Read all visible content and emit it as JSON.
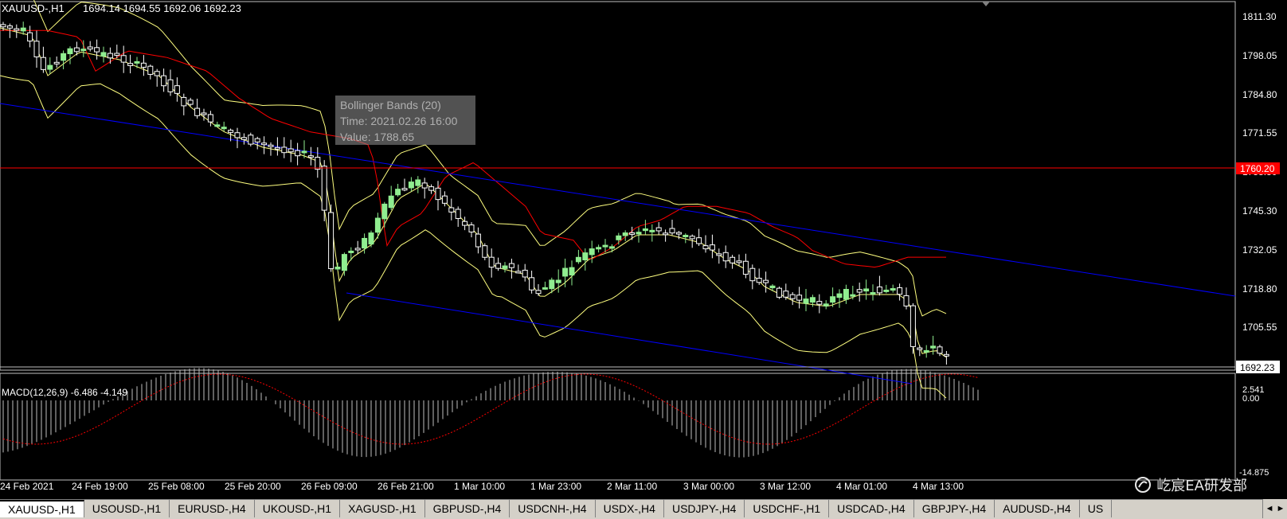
{
  "chart_header": {
    "symbol": "XAUUSD-,H1",
    "ohlc": "1694.14 1694.55 1692.06 1692.23"
  },
  "price_axis": {
    "ticks": [
      "1811.30",
      "1798.05",
      "1784.80",
      "1771.55",
      "1758.30",
      "1745.30",
      "1732.05",
      "1718.80",
      "1705.55"
    ],
    "hline_label": "1760.20",
    "current_label": "1692.23"
  },
  "macd": {
    "label": "MACD(12,26,9) -6.486 -4.149",
    "ticks": [
      "2.541",
      "0.00",
      "-14.875"
    ]
  },
  "time_axis": {
    "labels": [
      "24 Feb 2021",
      "24 Feb 19:00",
      "25 Feb 08:00",
      "25 Feb 20:00",
      "26 Feb 09:00",
      "26 Feb 21:00",
      "1 Mar 10:00",
      "1 Mar 23:00",
      "2 Mar 11:00",
      "3 Mar 00:00",
      "3 Mar 12:00",
      "4 Mar 01:00",
      "4 Mar 13:00"
    ]
  },
  "tooltip": {
    "line1": "Bollinger Bands (20)",
    "line2": "Time: 2021.02.26 16:00",
    "line3": "Value: 1788.65"
  },
  "watermark": {
    "text": "屹宸EA研发部"
  },
  "tabs": [
    "XAUUSD-,H1",
    "USOUSD-,H1",
    "EURUSD-,H4",
    "UKOUSD-,H1",
    "XAGUSD-,H1",
    "GBPUSD-,H4",
    "USDCNH-,H4",
    "USDX-,H4",
    "USDJPY-,H4",
    "USDCHF-,H1",
    "USDCAD-,H4",
    "GBPJPY-,H4",
    "AUDUSD-,H4",
    "US"
  ],
  "active_tab": 0,
  "colors": {
    "bull_candle": "#90ee90",
    "bear_candle": "#ffffff",
    "bollinger": "#ffff80",
    "moving_average": "#ff0000",
    "channel": "#0000ff",
    "hline": "#ff0000",
    "macd_histogram": "#c0c0c0",
    "macd_signal": "#ff0000"
  },
  "icons": {
    "scroll_marker": "triangle-down-icon",
    "tab_scroll": "arrow-left-right-icon"
  }
}
